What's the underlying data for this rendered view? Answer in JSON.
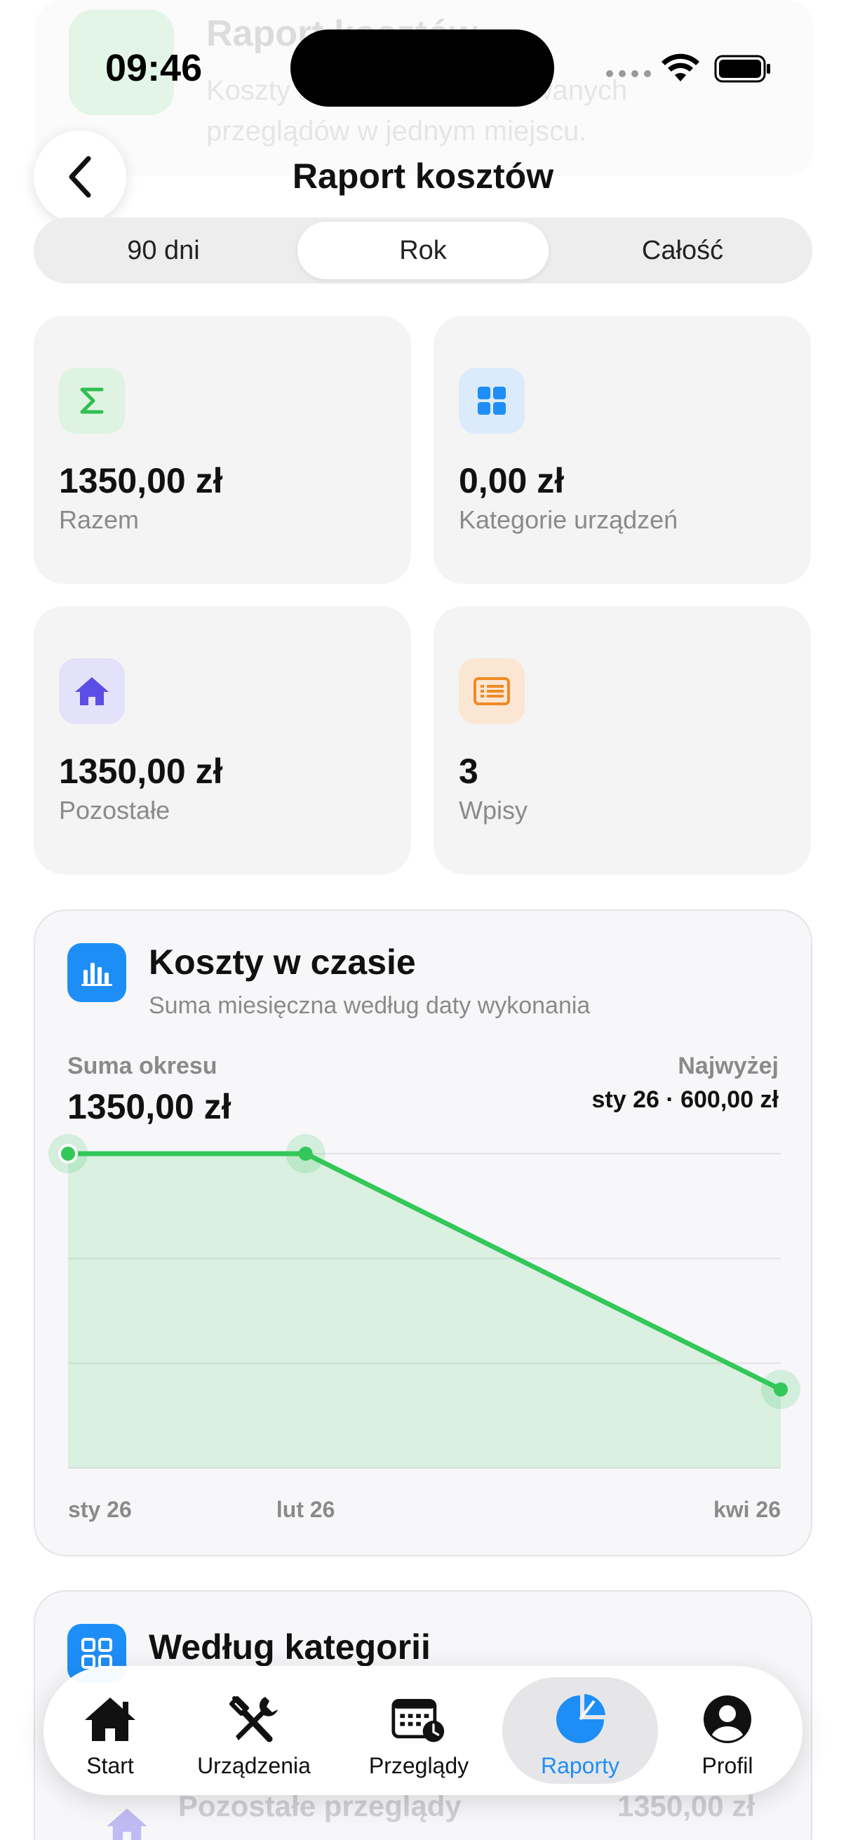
{
  "status_bar": {
    "time": "09:46"
  },
  "background": {
    "title": "Raport kosztów",
    "subtitle": "Koszty serwisów i zrealizowanych przeglądów w jednym miejscu."
  },
  "header": {
    "title": "Raport kosztów"
  },
  "segments": [
    {
      "label": "90 dni",
      "active": false
    },
    {
      "label": "Rok",
      "active": true
    },
    {
      "label": "Całość",
      "active": false
    }
  ],
  "tiles": [
    {
      "icon": "sigma-icon",
      "value": "1350,00 zł",
      "label": "Razem",
      "color": "#2fbf4f"
    },
    {
      "icon": "grid-icon",
      "value": "0,00 zł",
      "label": "Kategorie urządzeń",
      "color": "#1e8ef7"
    },
    {
      "icon": "house-icon",
      "value": "1350,00 zł",
      "label": "Pozostałe",
      "color": "#5b4ee6"
    },
    {
      "icon": "list-icon",
      "value": "3",
      "label": "Wpisy",
      "color": "#f08a24"
    }
  ],
  "chart_card": {
    "title": "Koszty w czasie",
    "subtitle": "Suma miesięczna według daty wykonania",
    "sum_label": "Suma okresu",
    "sum_value": "1350,00 zł",
    "max_label": "Najwyżej",
    "max_value": "sty 26 · 600,00 zł"
  },
  "chart_data": {
    "type": "area",
    "x": [
      "sty 26",
      "lut 26",
      "kwi 26"
    ],
    "x_ticks": [
      "sty 26",
      "lut 26",
      "kwi 26"
    ],
    "series": [
      {
        "values": [
          600,
          600,
          150
        ],
        "color": "#34c759"
      }
    ],
    "ylim": [
      0,
      600
    ],
    "grid": true
  },
  "category_card": {
    "title": "Według kategorii",
    "row_label": "Pozostałe przeglądy",
    "row_value": "1350,00 zł"
  },
  "tabbar": [
    {
      "icon": "house-icon",
      "label": "Start",
      "active": false
    },
    {
      "icon": "tools-icon",
      "label": "Urządzenia",
      "active": false
    },
    {
      "icon": "calendar-icon",
      "label": "Przeglądy",
      "active": false
    },
    {
      "icon": "pie-chart-icon",
      "label": "Raporty",
      "active": true
    },
    {
      "icon": "person-icon",
      "label": "Profil",
      "active": false
    }
  ]
}
